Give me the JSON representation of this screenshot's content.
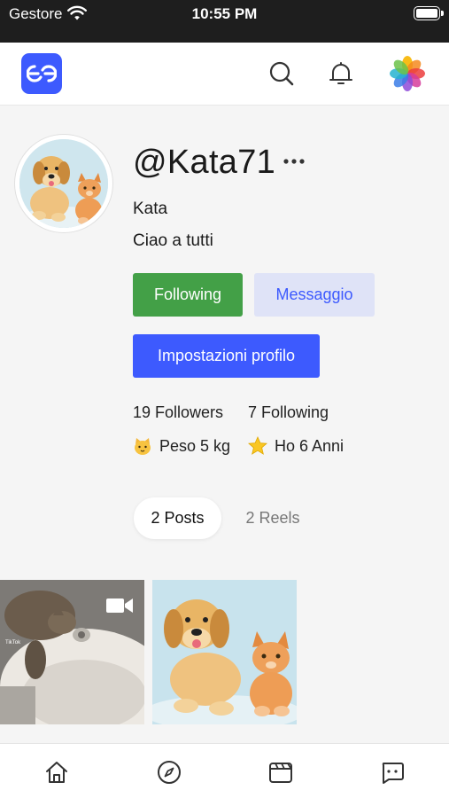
{
  "status_bar": {
    "carrier": "Gestore",
    "time": "10:55 PM"
  },
  "header": {
    "logo_icon": "app-logo-icon",
    "icons": [
      "search-icon",
      "bell-icon",
      "photos-icon"
    ],
    "brand_color": "#3d5afe"
  },
  "profile": {
    "username": "@Kata71",
    "display_name": "Kata",
    "bio": "Ciao a tutti",
    "buttons": {
      "following": "Following",
      "message": "Messaggio",
      "settings": "Impostazioni profilo"
    },
    "stats": {
      "followers": "19 Followers",
      "following": "7 Following"
    },
    "meta": {
      "weight": "Peso 5 kg",
      "age": "Ho 6 Anni"
    }
  },
  "tabs": {
    "posts": "2 Posts",
    "reels": "2 Reels"
  },
  "posts": [
    {
      "type": "video",
      "overlay_text": "TikTok"
    },
    {
      "type": "image"
    }
  ],
  "bottom_nav": [
    "home-icon",
    "explore-icon",
    "reels-icon",
    "chat-icon"
  ],
  "colors": {
    "following": "#43a047",
    "message_bg": "#dfe3f7",
    "settings": "#3d5afe"
  }
}
